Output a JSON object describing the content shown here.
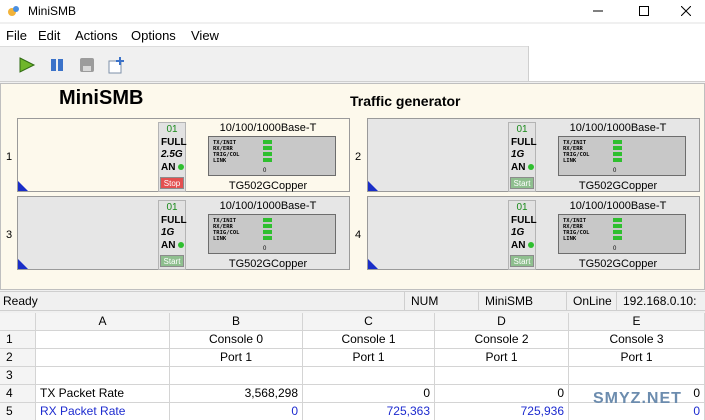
{
  "window": {
    "title": "MiniSMB"
  },
  "menu": [
    "File",
    "Edit",
    "Actions",
    "Options",
    "View"
  ],
  "toolbar": {
    "buttons": [
      "play-icon",
      "pause-icon",
      "disk-icon",
      "new-window-icon"
    ]
  },
  "header": {
    "brand": "MiniSMB",
    "subtitle": "Traffic generator"
  },
  "slots": [
    {
      "number": "1",
      "port_id": "01",
      "duplex": "FULL",
      "speed": "2.5G",
      "an": "AN",
      "button": "Stop",
      "active": true,
      "media": "10/100/1000Base-T",
      "card": "TG502GCopper"
    },
    {
      "number": "2",
      "port_id": "01",
      "duplex": "FULL",
      "speed": "1G",
      "an": "AN",
      "button": "Start",
      "active": false,
      "media": "10/100/1000Base-T",
      "card": "TG502GCopper"
    },
    {
      "number": "3",
      "port_id": "01",
      "duplex": "FULL",
      "speed": "1G",
      "an": "AN",
      "button": "Start",
      "active": false,
      "media": "10/100/1000Base-T",
      "card": "TG502GCopper"
    },
    {
      "number": "4",
      "port_id": "01",
      "duplex": "FULL",
      "speed": "1G",
      "an": "AN",
      "button": "Start",
      "active": false,
      "media": "10/100/1000Base-T",
      "card": "TG502GCopper"
    }
  ],
  "led_labels": [
    "TX/INIT",
    "RX/ERR",
    "TRIG/COL",
    "LINK"
  ],
  "led_count": "0",
  "status": {
    "ready": "Ready",
    "num": "NUM",
    "app": "MiniSMB",
    "online": "OnLine",
    "ip": "192.168.0.10:"
  },
  "grid": {
    "columns": [
      "A",
      "B",
      "C",
      "D",
      "E"
    ],
    "rows": [
      {
        "n": "1",
        "cells": [
          "",
          "Console 0",
          "Console 1",
          "Console 2",
          "Console 3"
        ]
      },
      {
        "n": "2",
        "cells": [
          "",
          "Port 1",
          "Port 1",
          "Port 1",
          "Port 1"
        ]
      },
      {
        "n": "3",
        "cells": [
          "",
          "",
          "",
          "",
          ""
        ]
      },
      {
        "n": "4",
        "cells": [
          "TX Packet Rate",
          "3,568,298",
          "0",
          "0",
          "0"
        ]
      },
      {
        "n": "5",
        "cells": [
          "RX Packet Rate",
          "0",
          "725,363",
          "725,936",
          "0"
        ]
      }
    ]
  },
  "watermark": "SMYZ.NET",
  "colors": {
    "accent_blue": "#1d2bcf",
    "led_green": "#2fbf2f",
    "stop_red": "#e45050",
    "panel_cream": "#fdf9ec"
  }
}
